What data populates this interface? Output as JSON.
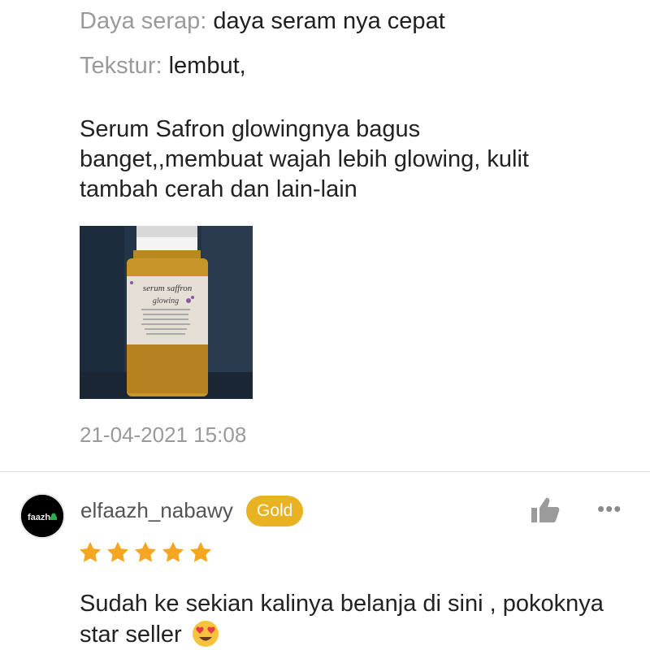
{
  "review1": {
    "attributes": [
      {
        "label": "Daya serap:",
        "value": "daya seram nya cepat"
      },
      {
        "label": "Tekstur:",
        "value": "lembut,"
      }
    ],
    "text": "Serum Safron glowingnya bagus banget,,membuat wajah lebih glowing, kulit tambah cerah dan lain-lain",
    "photo": {
      "bottle_label_line1": "serum saffron",
      "bottle_label_line2": "glowing"
    },
    "timestamp": "21-04-2021 15:08"
  },
  "review2": {
    "avatar_text": "faazh",
    "username": "elfaazh_nabawy",
    "badge": "Gold",
    "rating": 5,
    "text": "Sudah ke sekian kalinya belanja di sini , pokoknya star seller",
    "emoji_icon": "heart-eyes-emoji"
  },
  "icons": {
    "like": "thumbs-up-icon",
    "more": "more-options-icon",
    "star": "star-icon"
  },
  "colors": {
    "badge": "#e8b223",
    "star": "#f5a623",
    "label_gray": "#9a9a9a"
  }
}
